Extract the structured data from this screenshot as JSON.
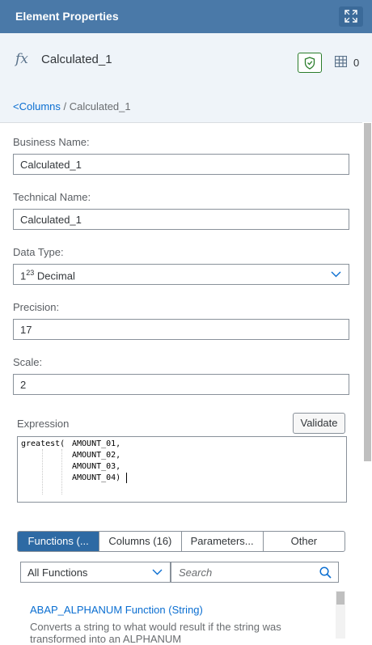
{
  "header": {
    "title": "Element Properties",
    "expand_icon": "fullscreen-icon"
  },
  "object": {
    "icon": "fx",
    "name": "Calculated_1",
    "shield_icon": "shield-icon",
    "columns_icon": "table-columns-icon",
    "column_count": "0"
  },
  "breadcrumb": {
    "link": "<Columns",
    "separator": " / ",
    "current": "Calculated_1"
  },
  "form": {
    "business_name_label": "Business Name:",
    "business_name_value": "Calculated_1",
    "technical_name_label": "Technical Name:",
    "technical_name_value": "Calculated_1",
    "data_type_label": "Data Type:",
    "data_type_prefix": "1",
    "data_type_sup": "23",
    "data_type_value": "Decimal",
    "precision_label": "Precision:",
    "precision_value": "17",
    "scale_label": "Scale:",
    "scale_value": "2"
  },
  "expression": {
    "label": "Expression",
    "validate_label": "Validate",
    "lines": [
      "greatest(",
      "AMOUNT_01,",
      "AMOUNT_02,",
      "AMOUNT_03,",
      "AMOUNT_04)"
    ]
  },
  "tabs": [
    {
      "label": "Functions (...",
      "active": true
    },
    {
      "label": "Columns (16)",
      "active": false
    },
    {
      "label": "Parameters...",
      "active": false
    },
    {
      "label": "Other",
      "active": false
    }
  ],
  "functions": {
    "filter_value": "All Functions",
    "search_placeholder": "Search",
    "items": [
      {
        "title": "ABAP_ALPHANUM Function (String)",
        "description": "Converts a string to what would result if the string was transformed into an ALPHANUM"
      }
    ]
  }
}
